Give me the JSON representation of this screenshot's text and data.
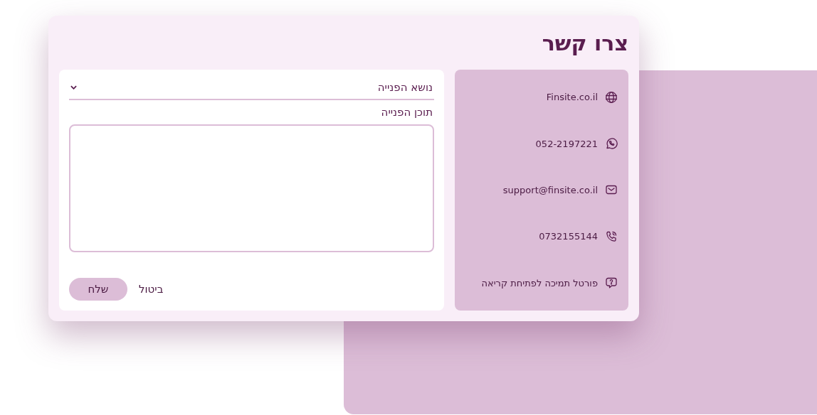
{
  "dialog": {
    "title": "צרו קשר"
  },
  "form": {
    "subject": {
      "placeholder": "נושא הפנייה"
    },
    "content": {
      "label": "תוכן הפנייה"
    },
    "buttons": [
      {
        "kind": "cancel",
        "label": "ביטול"
      },
      {
        "kind": "submit",
        "label": "שלח"
      }
    ]
  },
  "contacts": [
    {
      "kind": "website",
      "text": "Finsite.co.il"
    },
    {
      "kind": "whatsapp",
      "text": "052-2197221"
    },
    {
      "kind": "email",
      "text": "support@finsite.co.il"
    },
    {
      "kind": "phone",
      "text": "0732155144"
    },
    {
      "kind": "support",
      "text": "פורטל תמיכה לפתיחת קריאה"
    }
  ]
}
